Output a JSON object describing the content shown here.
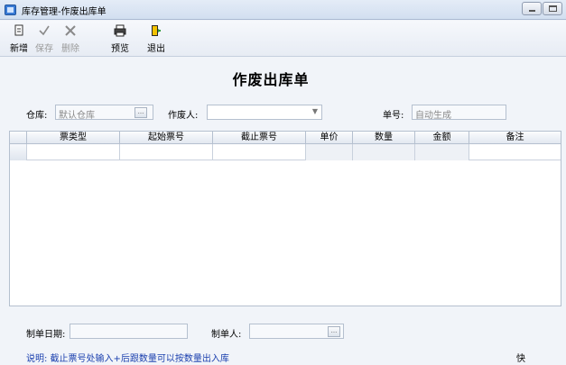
{
  "window": {
    "title": "库存管理-作废出库单"
  },
  "toolbar": {
    "items": [
      {
        "label": "新增",
        "icon": "new-doc-icon",
        "enabled": true
      },
      {
        "label": "保存",
        "icon": "checkmark-icon",
        "enabled": false
      },
      {
        "label": "删除",
        "icon": "delete-x-icon",
        "enabled": false
      },
      {
        "label": "预览",
        "icon": "printer-icon",
        "enabled": true
      },
      {
        "label": "退出",
        "icon": "exit-door-icon",
        "enabled": true
      }
    ]
  },
  "form": {
    "title": "作废出库单",
    "warehouse_label": "仓库:",
    "warehouse_value": "默认仓库",
    "voider_label": "作废人:",
    "voider_value": "",
    "number_label": "单号:",
    "number_placeholder": "自动生成"
  },
  "table": {
    "columns": [
      "票类型",
      "起始票号",
      "截止票号",
      "单价",
      "数量",
      "金额",
      "备注"
    ],
    "rows": [
      {
        "ticket_type": "",
        "start_no": "",
        "end_no": "",
        "price": "",
        "qty": "",
        "amount": "",
        "remark": ""
      }
    ]
  },
  "footer": {
    "date_label": "制单日期:",
    "date_value": "",
    "maker_label": "制单人:",
    "maker_value": "",
    "note": "说明: 截止票号处输入+后跟数量可以按数量出入库",
    "right_text": "快"
  },
  "colors": {
    "accent": "#3a7bd5",
    "note_text": "#1a3fae",
    "panel_bg": "#f1f4f9",
    "border": "#b5c0cf"
  }
}
